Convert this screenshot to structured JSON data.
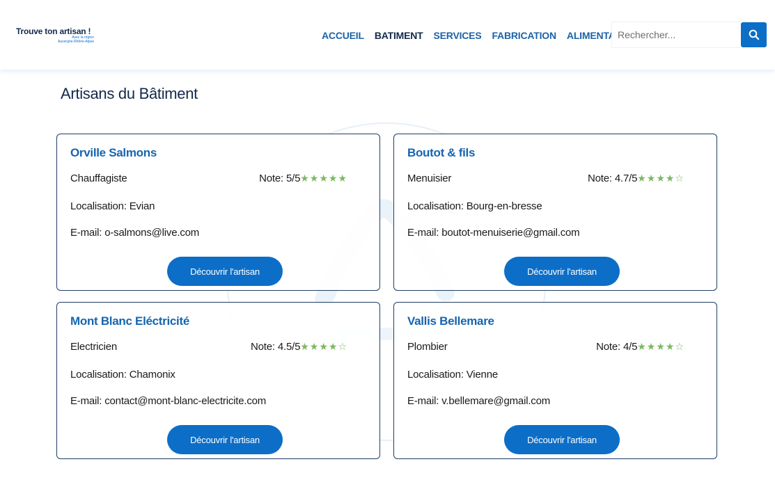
{
  "header": {
    "logo_title": "Trouve ton artisan !",
    "logo_sub_line1": "Avec la région",
    "logo_sub_line2": "Auvergne-Rhône-Alpes",
    "nav": [
      "ACCUEIL",
      "BATIMENT",
      "SERVICES",
      "FABRICATION",
      "ALIMENTATION"
    ],
    "active_nav": "BATIMENT",
    "search_placeholder": "Rechercher...",
    "search_icon": "search-icon"
  },
  "main": {
    "title": "Artisans du Bâtiment"
  },
  "artisans": [
    {
      "name": "Orville Salmons",
      "trade": "Chauffagiste",
      "note_label": "Note:",
      "note": "5/5",
      "rating": 5,
      "stars": "★★★★★",
      "location": "Localisation: Evian",
      "email": "E-mail: o-salmons@live.com",
      "button": "Découvrir l'artisan"
    },
    {
      "name": "Boutot & fils",
      "trade": "Menuisier",
      "note_label": "Note:",
      "note": "4.7/5",
      "rating": 4.7,
      "stars": "★★★★☆",
      "location": "Localisation: Bourg-en-bresse",
      "email": "E-mail: boutot-menuiserie@gmail.com",
      "button": "Découvrir l'artisan"
    },
    {
      "name": "Mont Blanc Eléctricité",
      "trade": "Electricien",
      "note_label": "Note:",
      "note": "4.5/5",
      "rating": 4.5,
      "stars": "★★★★☆",
      "location": "Localisation: Chamonix",
      "email": "E-mail: contact@mont-blanc-electricite.com",
      "button": "Découvrir l'artisan"
    },
    {
      "name": "Vallis Bellemare",
      "trade": "Plombier",
      "note_label": "Note:",
      "note": "4/5",
      "rating": 4,
      "stars": "★★★★☆",
      "location": "Localisation: Vienne",
      "email": "E-mail: v.bellemare@gmail.com",
      "button": "Découvrir l'artisan"
    }
  ],
  "colors": {
    "primary": "#0c6ec7",
    "navy": "#13294b",
    "link_blue": "#1565b0",
    "star_green": "#7bb85f",
    "card_border": "#1f3e66"
  }
}
